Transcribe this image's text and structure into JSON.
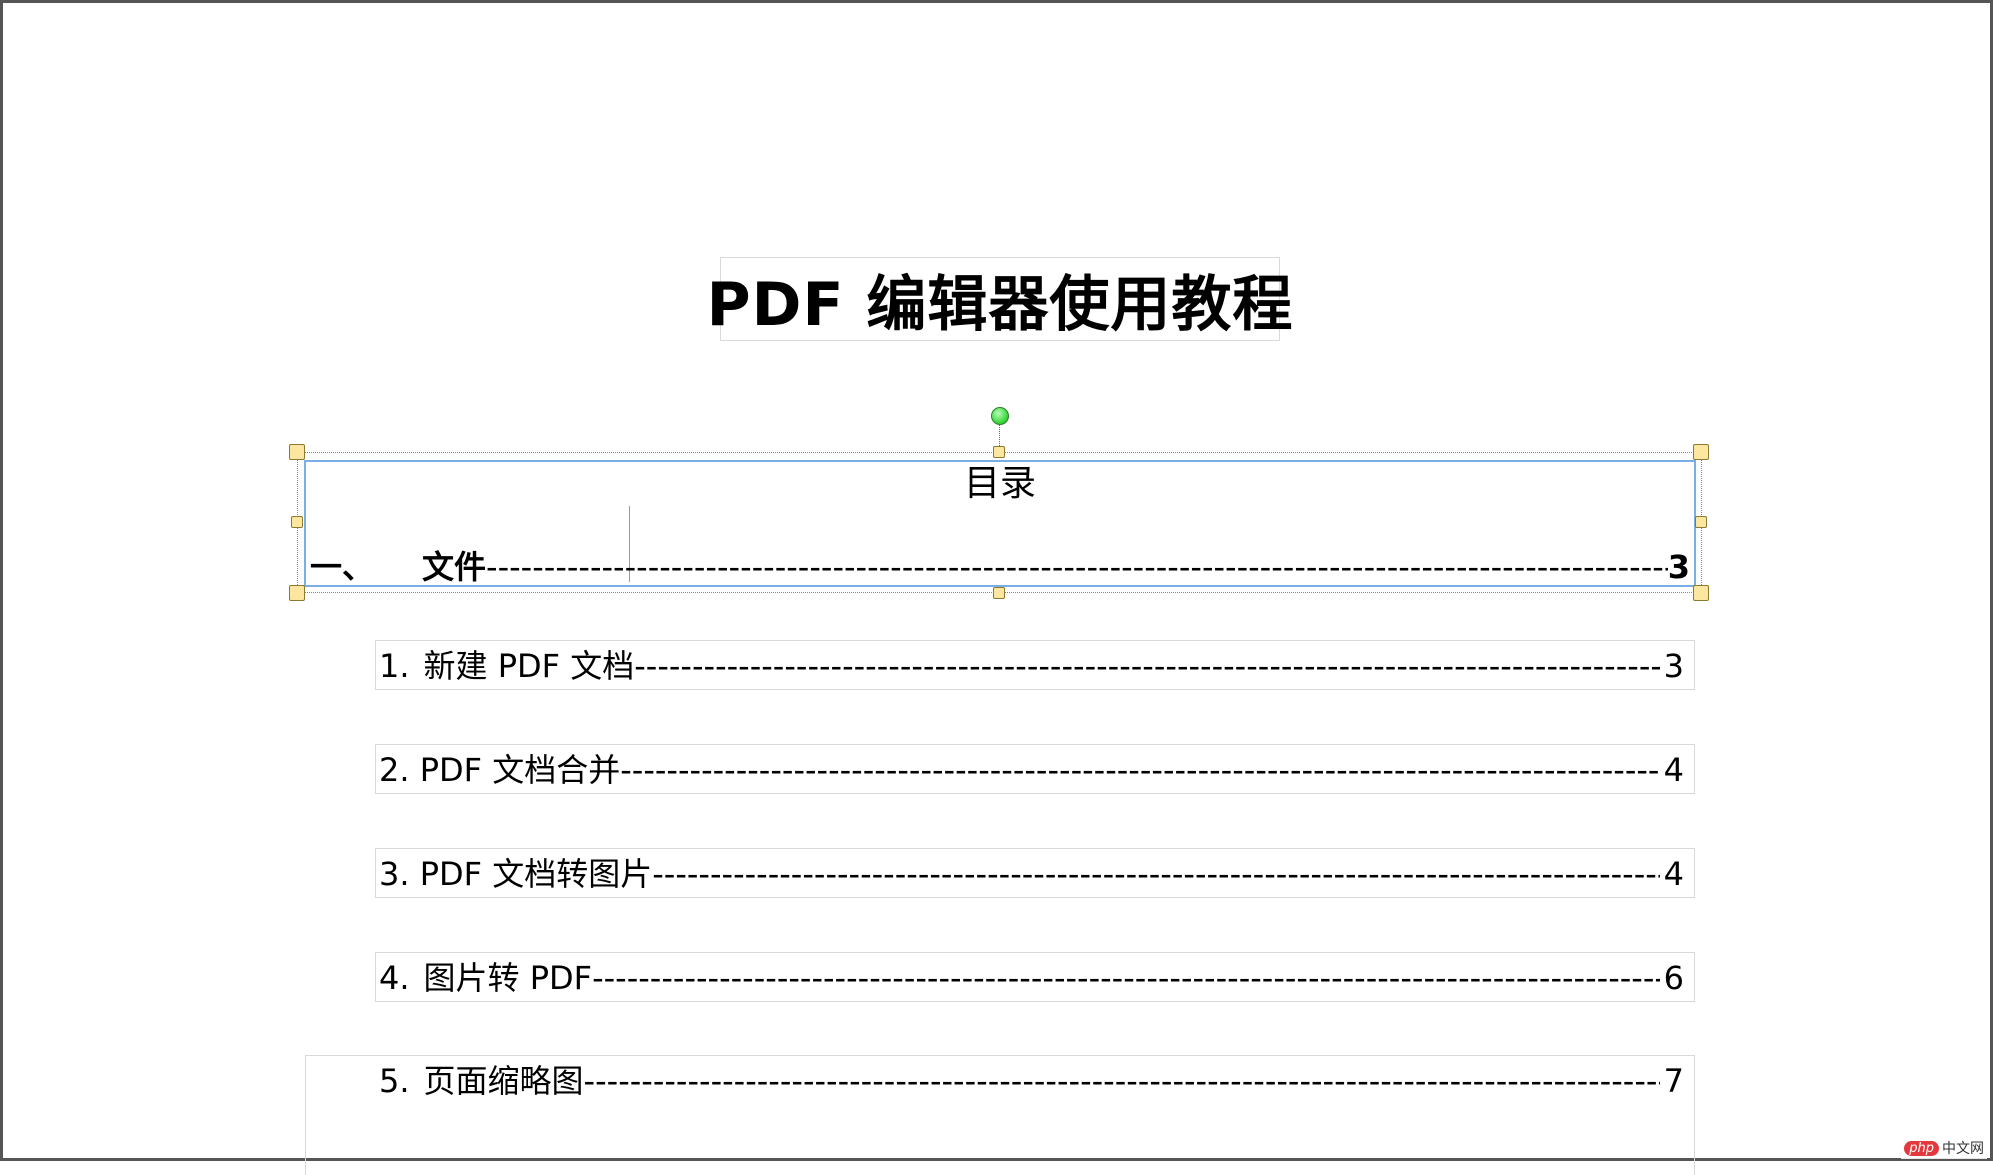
{
  "document": {
    "title": "PDF 编辑器使用教程",
    "toc_heading": "目录",
    "chapter": {
      "number": "一、",
      "label": "文件",
      "page": "3"
    },
    "entries": [
      {
        "number": "1.",
        "label": "新建 PDF 文档",
        "page": "3"
      },
      {
        "number": "2.",
        "label": "PDF 文档合并",
        "page": "4"
      },
      {
        "number": "3.",
        "label": "PDF 文档转图片",
        "page": "4"
      },
      {
        "number": "4.",
        "label": "图片转 PDF",
        "page": "6"
      },
      {
        "number": "5.",
        "label": "页面缩略图",
        "page": "7"
      }
    ]
  },
  "watermark": {
    "logo": "php",
    "text": "中文网"
  },
  "colors": {
    "selection_border": "#7aaee6",
    "handle_fill": "#fde7a0",
    "rotate_handle": "#2fd12f",
    "page_border": "#555555"
  }
}
